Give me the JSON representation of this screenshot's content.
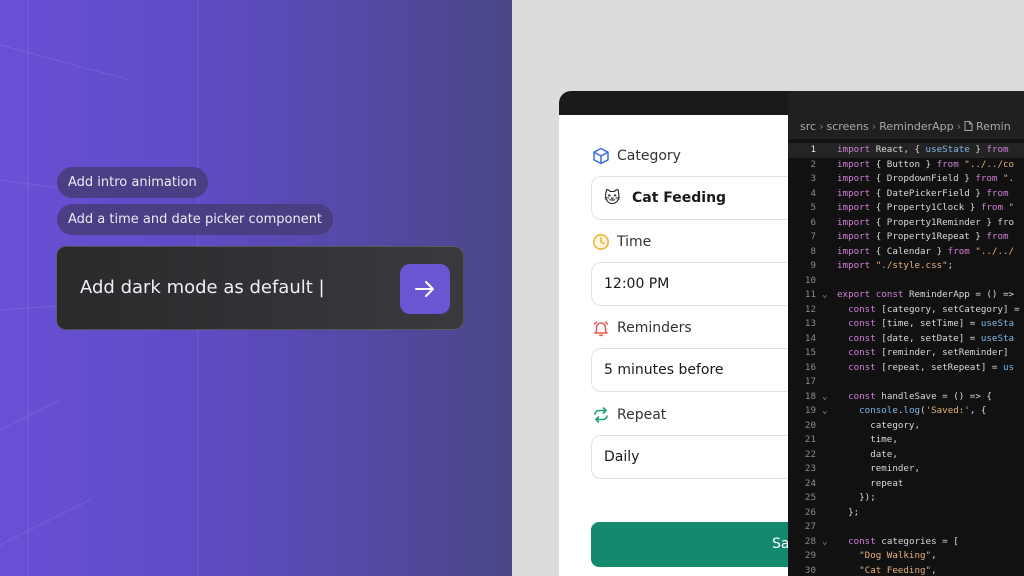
{
  "prompt_panel": {
    "suggestions": [
      "Add intro animation",
      "Add a time and date picker component"
    ],
    "input_value": "Add dark mode as default |",
    "send_icon": "arrow-right-icon",
    "accent_color": "#6c55d2"
  },
  "form": {
    "category": {
      "label": "Category",
      "icon": "cube-icon",
      "value": "Cat Feeding",
      "value_emoji": "🐱"
    },
    "time": {
      "label": "Time",
      "icon": "clock-icon",
      "value": "12:00 PM"
    },
    "reminders": {
      "label": "Reminders",
      "icon": "bell-icon",
      "value": "5 minutes before"
    },
    "repeat": {
      "label": "Repeat",
      "icon": "repeat-icon",
      "value": "Daily"
    },
    "save_label": "Sa",
    "save_color": "#13896e"
  },
  "editor": {
    "breadcrumb": [
      "src",
      "screens",
      "ReminderApp",
      "Remin"
    ],
    "breadcrumb_icon": "file-icon",
    "lines": [
      {
        "n": "1",
        "fold": "",
        "code": "import React, { useState } from "
      },
      {
        "n": "2",
        "fold": "",
        "code": "import { Button } from \"../../co"
      },
      {
        "n": "3",
        "fold": "",
        "code": "import { DropdownField } from \"."
      },
      {
        "n": "4",
        "fold": "",
        "code": "import { DatePickerField } from "
      },
      {
        "n": "5",
        "fold": "",
        "code": "import { Property1Clock } from \""
      },
      {
        "n": "6",
        "fold": "",
        "code": "import { Property1Reminder } fro"
      },
      {
        "n": "7",
        "fold": "",
        "code": "import { Property1Repeat } from "
      },
      {
        "n": "8",
        "fold": "",
        "code": "import { Calendar } from \"../../"
      },
      {
        "n": "9",
        "fold": "",
        "code": "import \"./style.css\";"
      },
      {
        "n": "10",
        "fold": "",
        "code": ""
      },
      {
        "n": "11",
        "fold": "⌄",
        "code": "export const ReminderApp = () =>"
      },
      {
        "n": "12",
        "fold": "",
        "code": "  const [category, setCategory] ="
      },
      {
        "n": "13",
        "fold": "",
        "code": "  const [time, setTime] = useSta"
      },
      {
        "n": "14",
        "fold": "",
        "code": "  const [date, setDate] = useSta"
      },
      {
        "n": "15",
        "fold": "",
        "code": "  const [reminder, setReminder] "
      },
      {
        "n": "16",
        "fold": "",
        "code": "  const [repeat, setRepeat] = us"
      },
      {
        "n": "17",
        "fold": "",
        "code": ""
      },
      {
        "n": "18",
        "fold": "⌄",
        "code": "  const handleSave = () => {"
      },
      {
        "n": "19",
        "fold": "⌄",
        "code": "    console.log('Saved:', {"
      },
      {
        "n": "20",
        "fold": "",
        "code": "      category,"
      },
      {
        "n": "21",
        "fold": "",
        "code": "      time,"
      },
      {
        "n": "22",
        "fold": "",
        "code": "      date,"
      },
      {
        "n": "23",
        "fold": "",
        "code": "      reminder,"
      },
      {
        "n": "24",
        "fold": "",
        "code": "      repeat"
      },
      {
        "n": "25",
        "fold": "",
        "code": "    });"
      },
      {
        "n": "26",
        "fold": "",
        "code": "  };"
      },
      {
        "n": "27",
        "fold": "",
        "code": ""
      },
      {
        "n": "28",
        "fold": "⌄",
        "code": "  const categories = ["
      },
      {
        "n": "29",
        "fold": "",
        "code": "    \"Dog Walking\","
      },
      {
        "n": "30",
        "fold": "",
        "code": "    \"Cat Feeding\","
      }
    ]
  }
}
